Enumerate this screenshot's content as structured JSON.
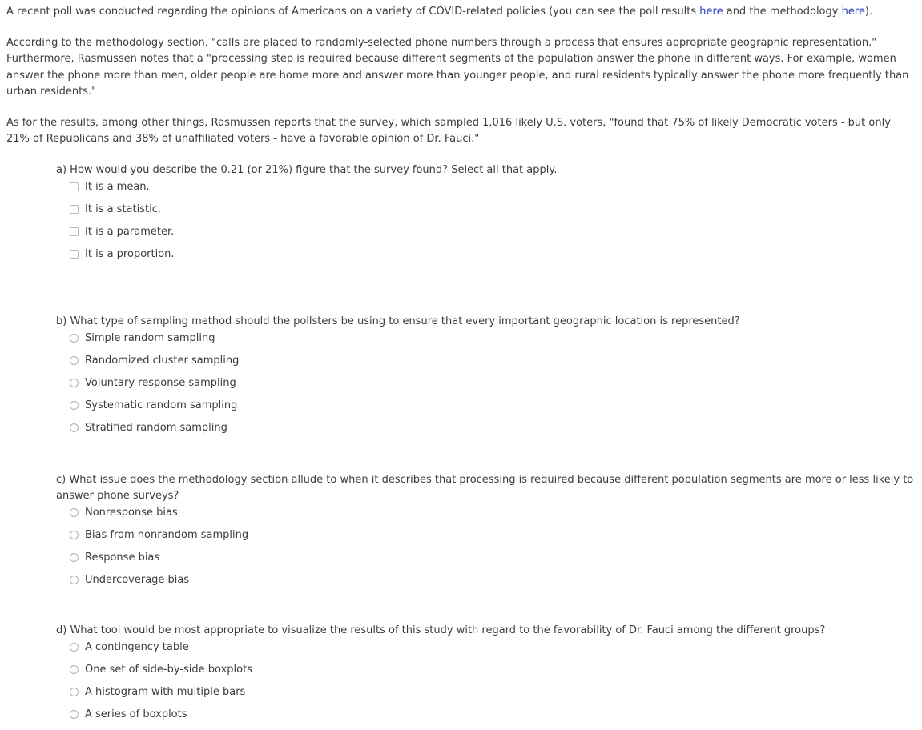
{
  "intro": {
    "para1_before_link1": "A recent poll was conducted regarding the opinions of Americans on a variety of COVID-related policies (you can see the poll results ",
    "link1": "here",
    "para1_between_links": " and the methodology ",
    "link2": "here",
    "para1_after_link2": ").",
    "para2": "According to the methodology section, \"calls are placed to randomly-selected phone numbers through a process that ensures appropriate geographic representation.\" Furthermore, Rasmussen notes that a \"processing step is required because different segments of the population answer the phone in different ways. For example, women answer the phone more than men, older people are home more and answer more than younger people, and rural residents typically answer the phone more frequently than urban residents.\"",
    "para3": "As for the results, among other things, Rasmussen reports that the survey, which sampled 1,016 likely U.S. voters, \"found that 75% of likely Democratic voters - but only 21% of Republicans and 38% of unaffiliated voters - have a favorable opinion of Dr. Fauci.\""
  },
  "colors": {
    "link": "#2b39c4",
    "text": "#3c3c3c",
    "control_border": "#b8b8b8",
    "background": "#ffffff"
  },
  "questions": [
    {
      "id": "a",
      "prompt": "a) How would you describe the 0.21 (or 21%) figure that the survey found? Select all that apply.",
      "input_type": "checkbox",
      "options": [
        "It is a mean.",
        "It is a statistic.",
        "It is a parameter.",
        "It is a proportion."
      ]
    },
    {
      "id": "b",
      "prompt": "b) What type of sampling method should the pollsters be using to ensure that every important geographic location is represented?",
      "input_type": "radio",
      "options": [
        "Simple random sampling",
        "Randomized cluster sampling",
        "Voluntary response sampling",
        "Systematic random sampling",
        "Stratified random sampling"
      ]
    },
    {
      "id": "c",
      "prompt": "c) What issue does the methodology section allude to when it describes that processing is required because different population segments are more or less likely to answer phone surveys?",
      "input_type": "radio",
      "options": [
        "Nonresponse bias",
        "Bias from nonrandom sampling",
        "Response bias",
        "Undercoverage bias"
      ]
    },
    {
      "id": "d",
      "prompt": "d) What tool would be most appropriate to visualize the results of this study with regard to the favorability of Dr. Fauci among the different groups?",
      "input_type": "radio",
      "options": [
        "A contingency table",
        "One set of side-by-side boxplots",
        "A histogram with multiple bars",
        "A series of boxplots"
      ]
    }
  ]
}
